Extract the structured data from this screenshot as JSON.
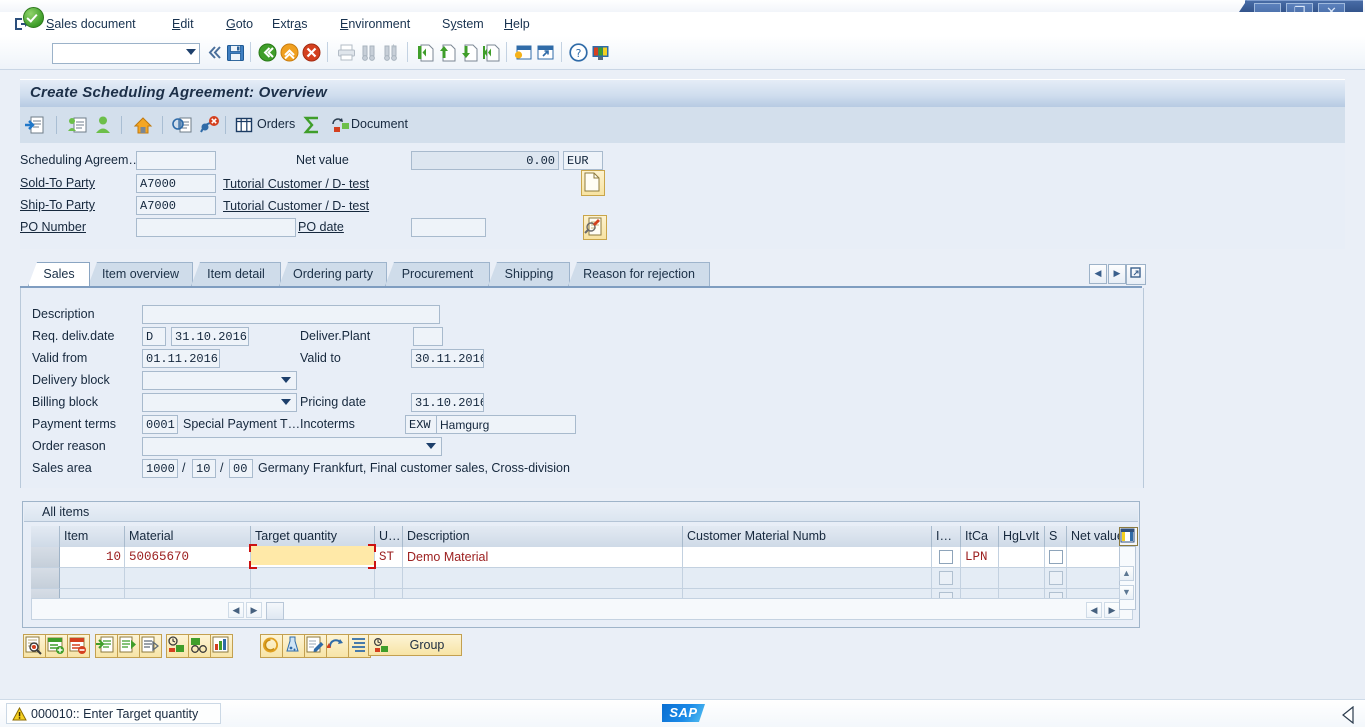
{
  "window": {
    "minimize_label": "–",
    "maximize_label": "❐",
    "close_label": "✕"
  },
  "menubar": {
    "system_icon": "document-exit-icon",
    "items": [
      {
        "label": "Sales document",
        "accel_index": 0
      },
      {
        "label": "Edit",
        "accel_index": 0
      },
      {
        "label": "Goto",
        "accel_index": 0
      },
      {
        "label": "Extras",
        "accel_index": 4
      },
      {
        "label": "Environment",
        "accel_index": 0
      },
      {
        "label": "System",
        "accel_index": 1
      },
      {
        "label": "Help",
        "accel_index": 0
      }
    ]
  },
  "system_toolbar": {
    "enter_icon": "green-check-enter-icon",
    "command_field": {
      "value": "",
      "placeholder": ""
    },
    "dropdown_icon": "chevron-down-icon",
    "collapse_icon": "double-chevron-left-icon",
    "icons": [
      "save-icon",
      "back-green-icon",
      "exit-yellow-icon",
      "cancel-red-icon",
      "print-icon",
      "find-icon",
      "find-next-icon",
      "first-page-icon",
      "previous-page-icon",
      "next-page-icon",
      "last-page-icon",
      "create-session-icon",
      "create-shortcut-icon",
      "help-icon",
      "customize-layout-icon"
    ]
  },
  "page": {
    "title": "Create Scheduling Agreement: Overview"
  },
  "app_toolbar": {
    "icons": [
      "search-document-icon",
      "display-document-icon",
      "business-partner-icon",
      "header-details-icon",
      "copy-document-icon",
      "reject-document-icon",
      "orders-table-icon",
      "sum-icon",
      "document-flow-icon"
    ],
    "buttons": [
      {
        "label": "Orders",
        "icon": "orders-table-icon"
      },
      {
        "label": "Document",
        "icon": "document-flow-icon"
      }
    ]
  },
  "header": {
    "agreement": {
      "label": "Scheduling Agreem…",
      "value": ""
    },
    "net_value": {
      "label": "Net value",
      "value": "0.00",
      "currency": "EUR"
    },
    "sold_to": {
      "label": "Sold-To Party",
      "value": "A7000",
      "description": "Tutorial Customer / D- test"
    },
    "ship_to": {
      "label": "Ship-To Party",
      "value": "A7000",
      "description": "Tutorial Customer / D- test"
    },
    "po_number": {
      "label": "PO Number",
      "value": ""
    },
    "po_date": {
      "label": "PO date",
      "value": ""
    },
    "partner_icon": "new-document-icon",
    "search_icon": "display-partner-icon"
  },
  "tabs": [
    {
      "label": "Sales",
      "active": true
    },
    {
      "label": "Item overview",
      "active": false
    },
    {
      "label": "Item detail",
      "active": false
    },
    {
      "label": "Ordering party",
      "active": false
    },
    {
      "label": "Procurement",
      "active": false
    },
    {
      "label": "Shipping",
      "active": false
    },
    {
      "label": "Reason for rejection",
      "active": false
    }
  ],
  "tab_nav": {
    "prev_icon": "triangle-left-icon",
    "next_icon": "triangle-right-icon",
    "list_icon": "tab-list-icon"
  },
  "sales_tab": {
    "description": {
      "label": "Description",
      "value": ""
    },
    "req_deliv_date": {
      "label": "Req. deliv.date",
      "type": "D",
      "value": "31.10.2016"
    },
    "deliver_plant": {
      "label": "Deliver.Plant",
      "value": ""
    },
    "valid_from": {
      "label": "Valid from",
      "value": "01.11.2016"
    },
    "valid_to": {
      "label": "Valid to",
      "value": "30.11.2016"
    },
    "delivery_block": {
      "label": "Delivery block",
      "value": ""
    },
    "billing_block": {
      "label": "Billing block",
      "value": ""
    },
    "pricing_date": {
      "label": "Pricing date",
      "value": "31.10.2016"
    },
    "payment_terms": {
      "label": "Payment terms",
      "code": "0001",
      "text": "Special Payment T…"
    },
    "incoterms": {
      "label": "Incoterms",
      "code": "EXW",
      "text": "Hamgurg"
    },
    "order_reason": {
      "label": "Order reason",
      "value": ""
    },
    "sales_area": {
      "label": "Sales area",
      "org": "1000",
      "channel": "10",
      "division": "00",
      "text": "Germany Frankfurt, Final customer sales, Cross-division"
    }
  },
  "items": {
    "title": "All items",
    "columns": [
      "Item",
      "Material",
      "Target quantity",
      "U…",
      "Description",
      "Customer Material Numb",
      "I…",
      "ItCa",
      "HgLvIt",
      "S",
      "Net value"
    ],
    "config_icon": "table-settings-icon",
    "rows": [
      {
        "item": "10",
        "material": "50065670",
        "target_quantity": "",
        "uom": "ST",
        "description": "Demo Material",
        "customer_material": "",
        "i": "",
        "itca": "LPN",
        "hglvit": "",
        "s": "",
        "net_value": ""
      },
      {
        "item": "",
        "material": "",
        "target_quantity": "",
        "uom": "",
        "description": "",
        "customer_material": "",
        "i": "",
        "itca": "",
        "hglvit": "",
        "s": "",
        "net_value": ""
      },
      {
        "item": "",
        "material": "",
        "target_quantity": "",
        "uom": "",
        "description": "",
        "customer_material": "",
        "i": "",
        "itca": "",
        "hglvit": "",
        "s": "",
        "net_value": ""
      }
    ],
    "scroll": {
      "up_icon": "scroll-up-icon",
      "down_icon": "scroll-down-icon",
      "left_icon": "scroll-left-icon",
      "right_icon": "scroll-right-icon"
    }
  },
  "footer_toolbar": {
    "icons": [
      "display-item-icon",
      "insert-row-icon",
      "delete-row-icon",
      "item-detail-icon",
      "next-item-icon",
      "item-list-icon",
      "schedule-lines-icon",
      "availability-icon",
      "report-icon",
      "pricing-icon",
      "configuration-icon",
      "edit-note-icon",
      "rejection-icon",
      "structure-icon",
      "group-icon"
    ],
    "group_button": {
      "label": "Group",
      "icon": "group-icon"
    }
  },
  "status": {
    "icon": "warning-icon",
    "message": "000010:: Enter Target quantity",
    "logo": "SAP"
  },
  "colors": {
    "accent_blue": "#2e4f86",
    "page_bg": "#e8eef7",
    "title_band": "#cfddee",
    "focus_yellow": "#ffe9a8",
    "focus_bracket_red": "#cc1111",
    "data_red": "#9c2020",
    "button_yellow": "#f7e4a6",
    "sap_logo_blue": "#0a6ed1"
  }
}
